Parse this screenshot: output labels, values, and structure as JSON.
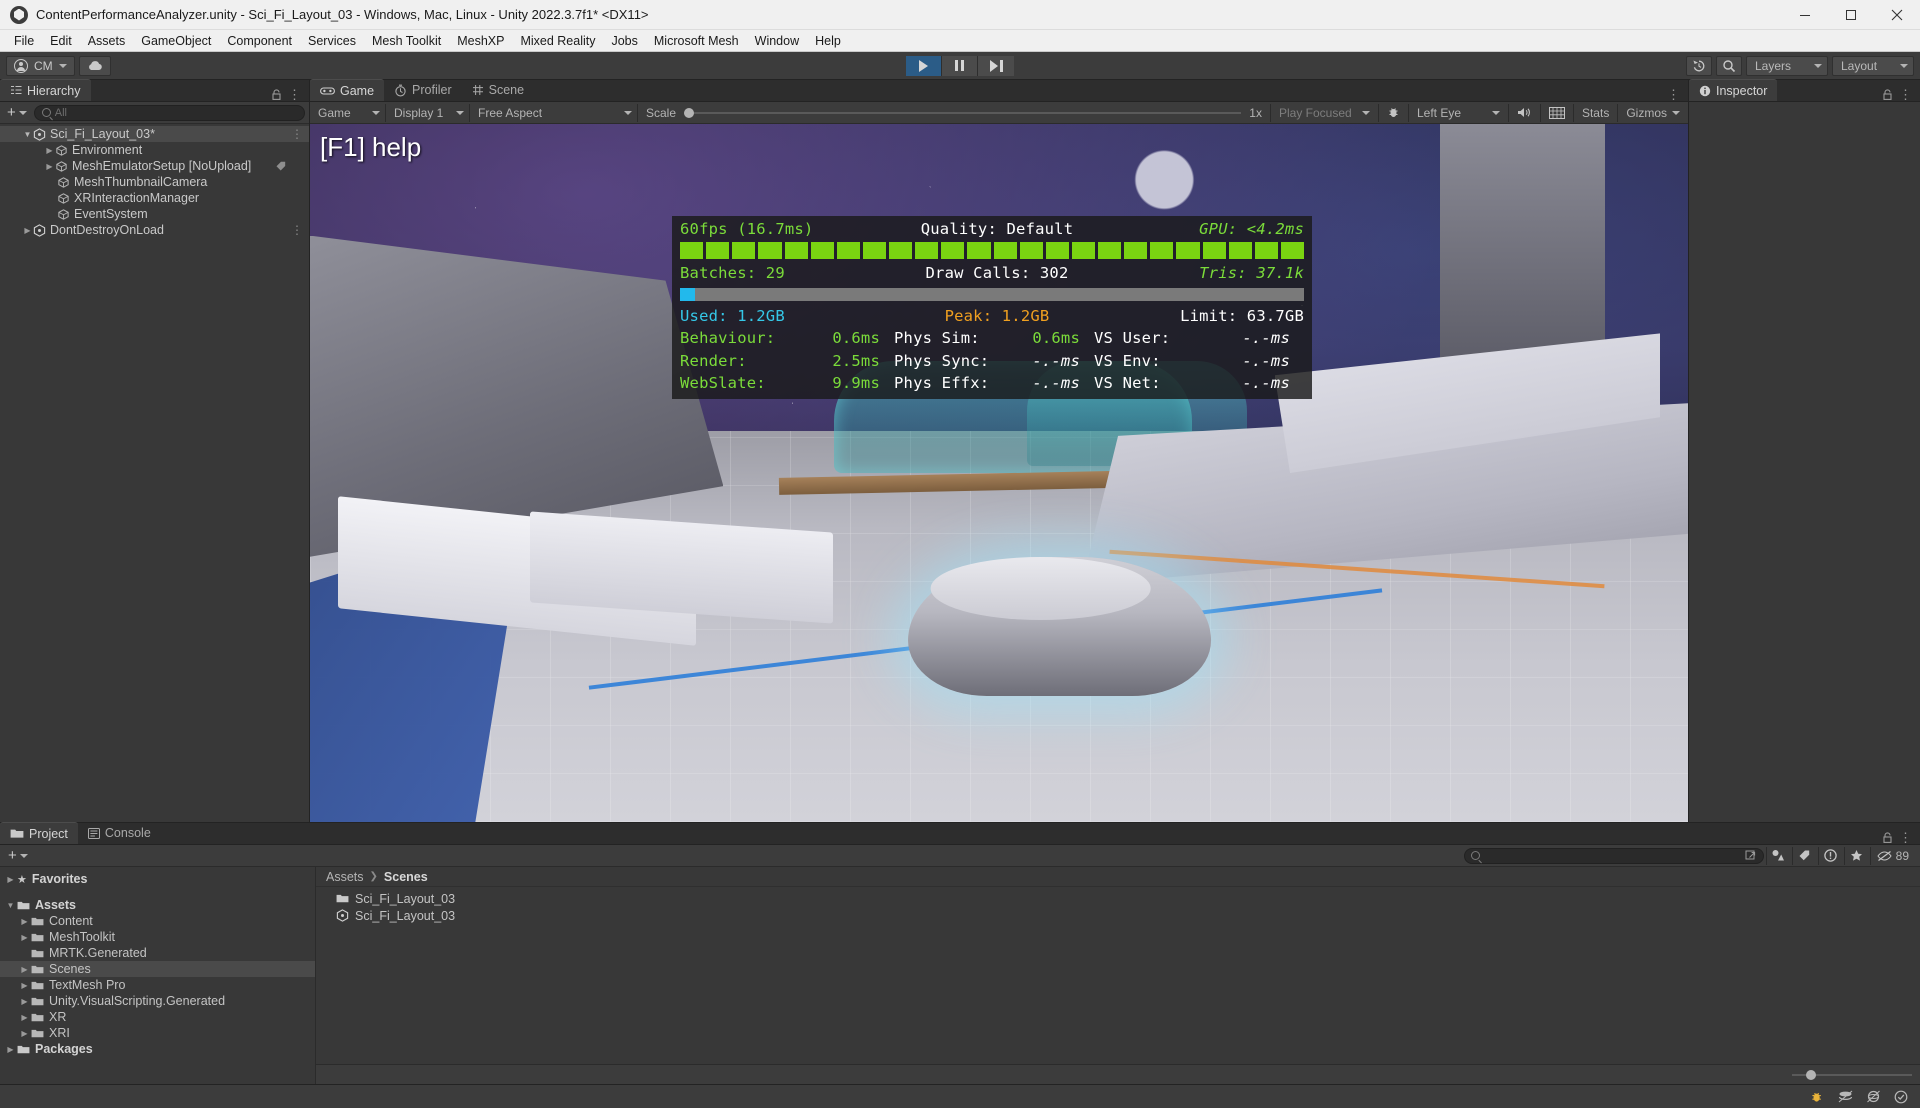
{
  "window": {
    "title": "ContentPerformanceAnalyzer.unity - Sci_Fi_Layout_03 - Windows, Mac, Linux - Unity 2022.3.7f1* <DX11>",
    "minimize_label": "minimize-icon",
    "maximize_label": "maximize-icon",
    "close_label": "close-icon"
  },
  "menubar": {
    "items": [
      {
        "label": "File"
      },
      {
        "label": "Edit"
      },
      {
        "label": "Assets"
      },
      {
        "label": "GameObject"
      },
      {
        "label": "Component"
      },
      {
        "label": "Services"
      },
      {
        "label": "Mesh Toolkit"
      },
      {
        "label": "MeshXP"
      },
      {
        "label": "Mixed Reality"
      },
      {
        "label": "Jobs"
      },
      {
        "label": "Microsoft Mesh"
      },
      {
        "label": "Window"
      },
      {
        "label": "Help"
      }
    ]
  },
  "toolbar": {
    "account_label": "CM",
    "cloud_icon": "cloud-icon",
    "play_icon": "play-icon",
    "pause_icon": "pause-icon",
    "step_icon": "step-icon",
    "history_icon": "undo-history-icon",
    "search_icon": "search-icon",
    "layers_label": "Layers",
    "layout_label": "Layout"
  },
  "hierarchy": {
    "tab_label": "Hierarchy",
    "lock_icon": "lock-icon",
    "menu_icon": "kebab-menu-icon",
    "add_label": "+",
    "search_placeholder": "All",
    "items": [
      {
        "label": "Sci_Fi_Layout_03*",
        "indent": 0,
        "arrow": "open",
        "icon": "scene-icon",
        "selected": true,
        "kebab": true
      },
      {
        "label": "Environment",
        "indent": 1,
        "arrow": "closed",
        "icon": "cube-icon"
      },
      {
        "label": "MeshEmulatorSetup [NoUpload]",
        "indent": 1,
        "arrow": "closed",
        "icon": "cube-icon",
        "tag": true
      },
      {
        "label": "MeshThumbnailCamera",
        "indent": 2,
        "arrow": "none",
        "icon": "cube-icon"
      },
      {
        "label": "XRInteractionManager",
        "indent": 2,
        "arrow": "none",
        "icon": "cube-icon"
      },
      {
        "label": "EventSystem",
        "indent": 2,
        "arrow": "none",
        "icon": "cube-icon"
      },
      {
        "label": "DontDestroyOnLoad",
        "indent": 0,
        "arrow": "closed",
        "icon": "scene-icon",
        "kebab": true
      }
    ]
  },
  "gameview": {
    "tabs": [
      {
        "label": "Game",
        "icon": "gamepad-icon",
        "active": true
      },
      {
        "label": "Profiler",
        "icon": "stopwatch-icon",
        "active": false
      },
      {
        "label": "Scene",
        "icon": "grid-hash-icon",
        "active": false
      }
    ],
    "menu_icon": "kebab-menu-icon",
    "display_mode": "Game",
    "display": "Display 1",
    "aspect": "Free Aspect",
    "scale_label": "Scale",
    "scale_value": "1x",
    "play_mode": "Play Focused",
    "bug_icon": "bug-icon",
    "eye_mode": "Left Eye",
    "mute_icon": "speaker-icon",
    "stats_grid_icon": "grid-icon",
    "stats_label": "Stats",
    "gizmos_label": "Gizmos",
    "help_overlay": "[F1] help"
  },
  "perf_overlay": {
    "fps": "60fps (16.7ms)",
    "quality": "Quality: Default",
    "gpu": "GPU: <4.2ms",
    "batches": "Batches: 29",
    "draw_calls": "Draw Calls: 302",
    "tris": "Tris: 37.1k",
    "mem_used": "Used: 1.2GB",
    "mem_peak": "Peak: 1.2GB",
    "mem_limit": "Limit: 63.7GB",
    "rows": [
      {
        "c1_label": "Behaviour:",
        "c1_value": "0.6ms",
        "c2_label": "Phys Sim:",
        "c2_value": "0.6ms",
        "c3_label": "VS User:",
        "c3_value": "-.-ms"
      },
      {
        "c1_label": "Render:",
        "c1_value": "2.5ms",
        "c2_label": "Phys Sync:",
        "c2_value": "-.-ms",
        "c3_label": "VS Env:",
        "c3_value": "-.-ms"
      },
      {
        "c1_label": "WebSlate:",
        "c1_value": "9.9ms",
        "c2_label": "Phys Effx:",
        "c2_value": "-.-ms",
        "c3_label": "VS Net:",
        "c3_value": "-.-ms"
      }
    ],
    "fps_bar_count": 24,
    "colors": {
      "green": "#7bdc3a",
      "white": "#ffffff",
      "cyan": "#35c8e8",
      "orange": "#f0a020",
      "bar_green": "#7ad411",
      "bar_blue": "#22b9ec"
    }
  },
  "inspector": {
    "tab_label": "Inspector",
    "info_icon": "info-icon",
    "lock_icon": "lock-icon",
    "menu_icon": "kebab-menu-icon"
  },
  "project": {
    "tabs": [
      {
        "label": "Project",
        "icon": "folder-icon",
        "active": true
      },
      {
        "label": "Console",
        "icon": "console-icon",
        "active": false
      }
    ],
    "lock_icon": "lock-icon",
    "menu_icon": "kebab-menu-icon",
    "add_label": "+",
    "search_placeholder": "",
    "search_icon": "search-icon",
    "toolbar_icons": [
      "open-in-new-icon",
      "asset-filter-icon",
      "label-tag-icon",
      "warning-icon",
      "favorite-star-icon",
      "hidden-eye-icon"
    ],
    "hidden_count": "89",
    "tree": [
      {
        "label": "Favorites",
        "indent": 0,
        "arrow": "closed",
        "icon": "star-icon",
        "bold": true
      },
      {
        "label": "Assets",
        "indent": 0,
        "arrow": "open",
        "icon": "folder-open-icon",
        "bold": true
      },
      {
        "label": "Content",
        "indent": 1,
        "arrow": "closed",
        "icon": "folder-icon"
      },
      {
        "label": "MeshToolkit",
        "indent": 1,
        "arrow": "closed",
        "icon": "folder-icon"
      },
      {
        "label": "MRTK.Generated",
        "indent": 1,
        "arrow": "none",
        "icon": "folder-icon"
      },
      {
        "label": "Scenes",
        "indent": 1,
        "arrow": "closed",
        "icon": "folder-icon",
        "selected": true
      },
      {
        "label": "TextMesh Pro",
        "indent": 1,
        "arrow": "closed",
        "icon": "folder-icon"
      },
      {
        "label": "Unity.VisualScripting.Generated",
        "indent": 1,
        "arrow": "closed",
        "icon": "folder-icon"
      },
      {
        "label": "XR",
        "indent": 1,
        "arrow": "closed",
        "icon": "folder-icon"
      },
      {
        "label": "XRI",
        "indent": 1,
        "arrow": "closed",
        "icon": "folder-icon"
      },
      {
        "label": "Packages",
        "indent": 0,
        "arrow": "closed",
        "icon": "folder-icon",
        "bold": true
      }
    ],
    "breadcrumb": {
      "root": "Assets",
      "current": "Scenes"
    },
    "items": [
      {
        "label": "Sci_Fi_Layout_03",
        "icon": "folder-icon"
      },
      {
        "label": "Sci_Fi_Layout_03",
        "icon": "scene-icon"
      }
    ]
  },
  "statusbar": {
    "icons": [
      "bug-yellow-icon",
      "layers-stack-icon",
      "no-preview-icon",
      "check-circle-icon"
    ]
  }
}
